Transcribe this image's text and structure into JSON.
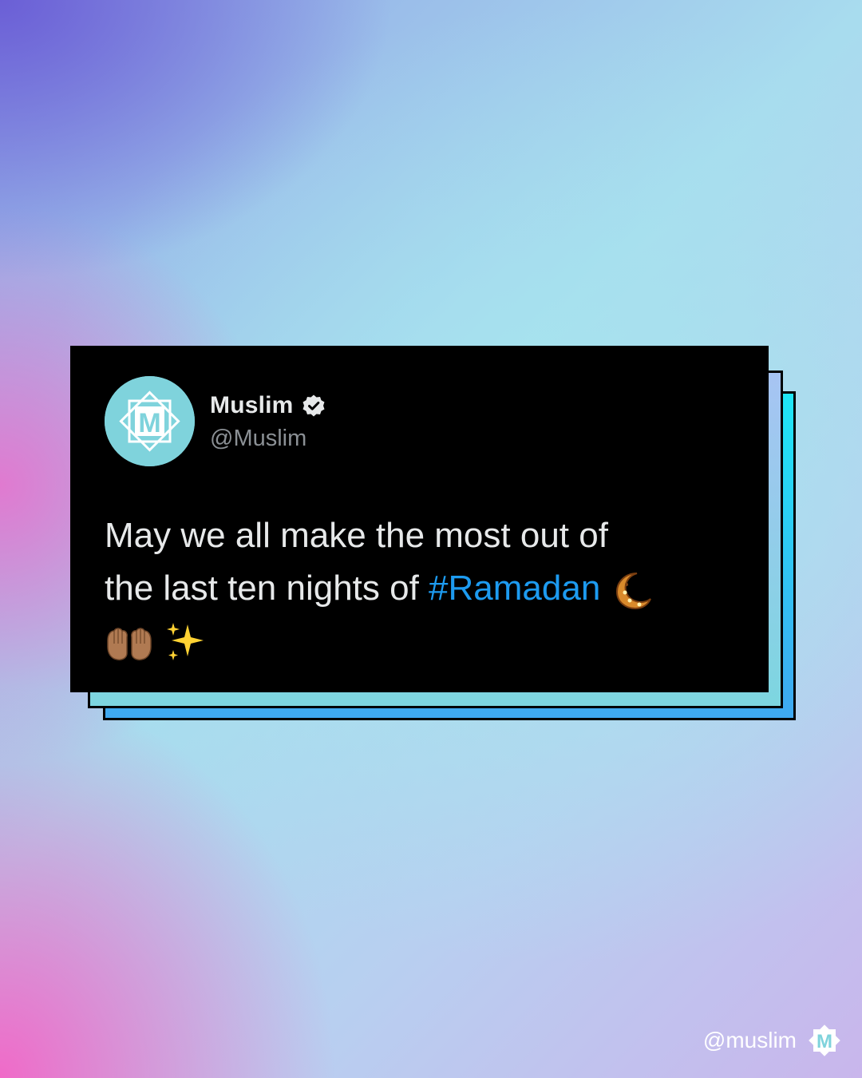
{
  "tweet": {
    "display_name": "Muslim",
    "handle": "@Muslim",
    "avatar_letter": "M",
    "text_line1": "May we all make the most out of",
    "text_line2_prefix": "the last ten nights of ",
    "hashtag": "#Ramadan",
    "icons": [
      "verified-badge-icon",
      "crescent-moon-icon",
      "raised-hands-icon",
      "sparkles-icon"
    ]
  },
  "footer": {
    "handle": "@muslim",
    "logo_letter": "M"
  },
  "colors": {
    "card_background": "#000000",
    "text": "#e7e9ea",
    "handle_gray": "#8b9095",
    "hashtag_blue": "#1d9bf0",
    "avatar_teal": "#7fd3dc"
  }
}
